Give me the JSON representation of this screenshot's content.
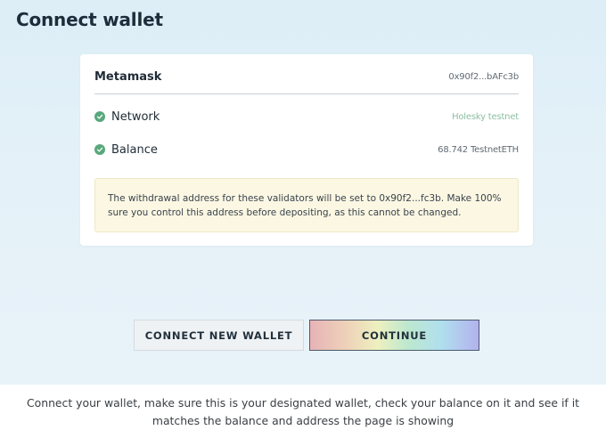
{
  "header": {
    "title": "Connect wallet"
  },
  "wallet": {
    "name": "Metamask",
    "address": "0x90f2...bAFc3b"
  },
  "network": {
    "label": "Network",
    "value": "Holesky testnet",
    "status_icon": "check-circle-icon"
  },
  "balance": {
    "label": "Balance",
    "value": "68.742 TestnetETH",
    "status_icon": "check-circle-icon"
  },
  "notice": {
    "text": "The withdrawal address for these validators will be set to 0x90f2...fc3b. Make 100% sure you control this address before depositing, as this cannot be changed."
  },
  "actions": {
    "connect_new_wallet": "CONNECT NEW WALLET",
    "continue": "CONTINUE"
  },
  "caption": {
    "text": "Connect your wallet, make sure this is your designated wallet, check your balance on it and see if it matches the balance and address the page is showing"
  },
  "colors": {
    "check_green": "#58a87b",
    "network_value": "#8bbfa2",
    "notice_bg": "#fbf7e3"
  }
}
